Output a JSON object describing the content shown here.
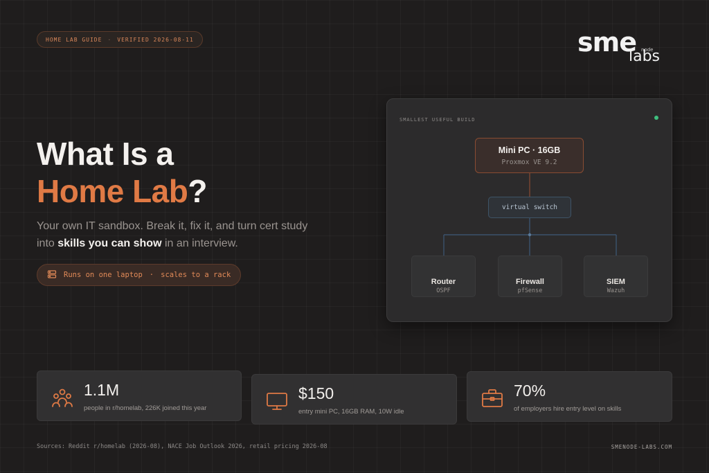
{
  "header": {
    "badge_left": "HOME LAB GUIDE",
    "badge_separator": "·",
    "badge_right": "VERIFIED 2026-08-11"
  },
  "logo": {
    "primary": "sme",
    "secondary": "labs",
    "tag": "node"
  },
  "hero": {
    "title_line1": "What Is a",
    "title_accent": "Home Lab",
    "title_suffix": "?",
    "subtitle_before": "Your own IT sandbox. Break it, fix it, and turn cert study into ",
    "subtitle_bold": "skills you can show",
    "subtitle_after": " in an interview.",
    "pill_left": "Runs on one laptop",
    "pill_separator": "·",
    "pill_right": "scales to a rack",
    "pill_icon": "server-icon"
  },
  "diagram": {
    "label": "SMALLEST USEFUL BUILD",
    "status_color": "#3fbf7f",
    "host_title": "Mini PC · 16GB",
    "host_subtitle": "Proxmox VE 9.2",
    "switch_label": "virtual switch",
    "leaves": [
      {
        "title": "Router",
        "subtitle": "OSPF"
      },
      {
        "title": "Firewall",
        "subtitle": "pfSense"
      },
      {
        "title": "SIEM",
        "subtitle": "Wazuh"
      }
    ]
  },
  "stats": [
    {
      "icon": "people-icon",
      "value": "1.1M",
      "desc": "people in r/homelab, 226K joined this year"
    },
    {
      "icon": "monitor-icon",
      "value": "$150",
      "desc": "entry mini PC, 16GB RAM, 10W idle"
    },
    {
      "icon": "briefcase-icon",
      "value": "70%",
      "desc": "of employers hire entry level on skills"
    }
  ],
  "footer": {
    "sources": "Sources: Reddit r/homelab (2026-08), NACE Job Outlook 2026, retail pricing 2026-08",
    "url": "SMENODE-LABS.COM"
  },
  "colors": {
    "accent": "#e07a45",
    "background": "#1f1d1d"
  }
}
